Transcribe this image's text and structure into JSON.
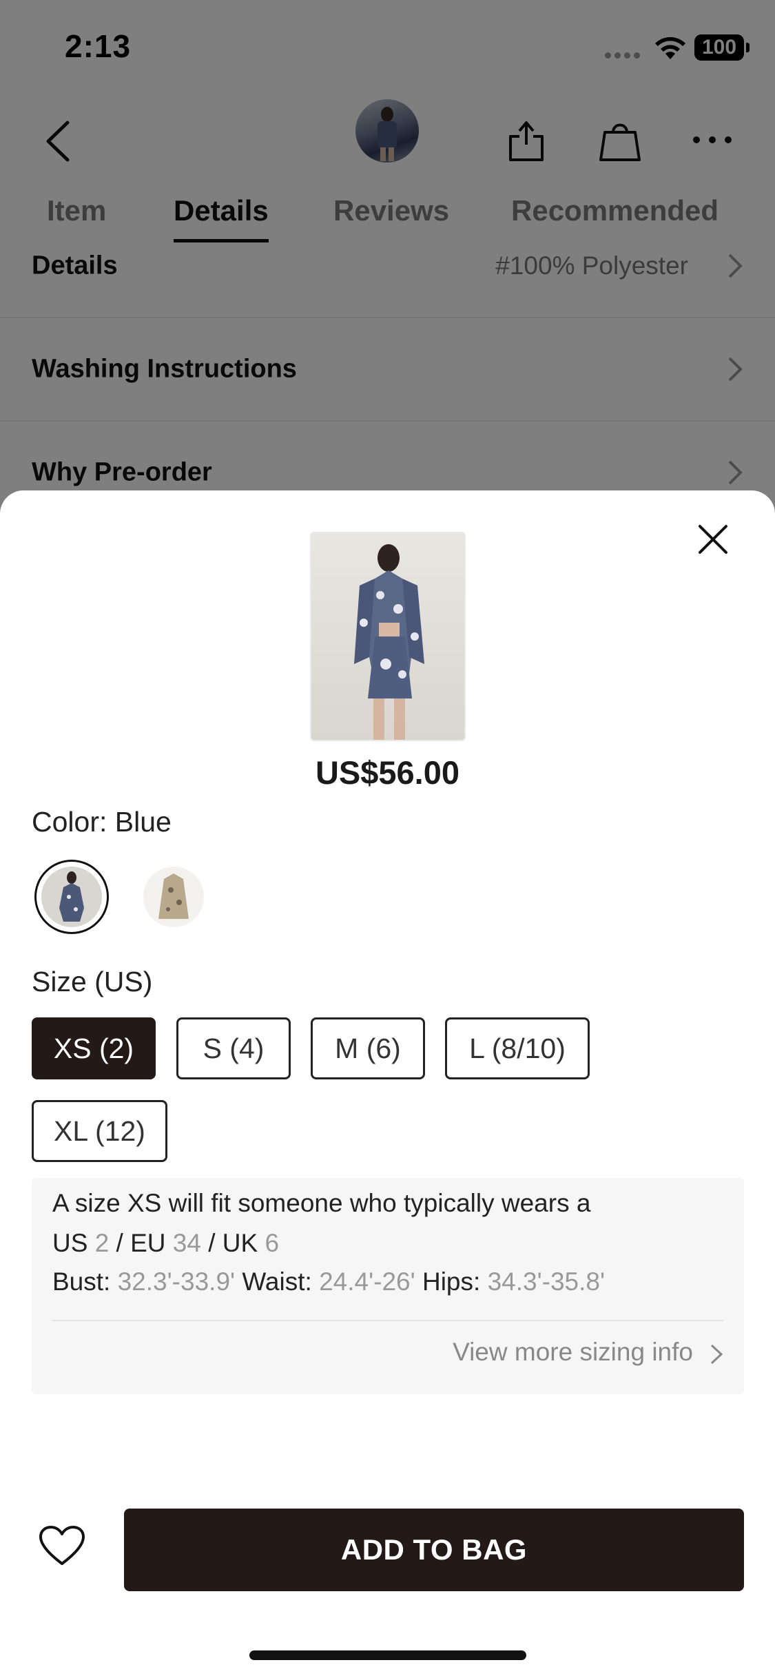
{
  "status_bar": {
    "time": "2:13",
    "battery": "100"
  },
  "nav": {
    "back_icon": "chevron-left-icon",
    "share_icon": "share-icon",
    "bag_icon": "shopping-bag-icon",
    "more_icon": "more-dots-icon"
  },
  "tabs": [
    {
      "label": "Item",
      "active": false
    },
    {
      "label": "Details",
      "active": true
    },
    {
      "label": "Reviews",
      "active": false
    },
    {
      "label": "Recommended",
      "active": false
    }
  ],
  "detail_rows": [
    {
      "label": "Details",
      "value": "#100% Polyester"
    },
    {
      "label": "Washing Instructions",
      "value": ""
    },
    {
      "label": "Why Pre-order",
      "value": ""
    }
  ],
  "sheet": {
    "price": "US$56.00",
    "color_label": "Color: Blue",
    "colors": [
      {
        "name": "Blue",
        "selected": true,
        "tone": "#4b5878"
      },
      {
        "name": "Beige",
        "selected": false,
        "tone": "#b8a88c"
      }
    ],
    "size_label": "Size (US)",
    "sizes": [
      {
        "label": "XS (2)",
        "selected": true
      },
      {
        "label": "S (4)",
        "selected": false
      },
      {
        "label": "M (6)",
        "selected": false
      },
      {
        "label": "L (8/10)",
        "selected": false
      },
      {
        "label": "XL (12)",
        "selected": false
      }
    ],
    "size_info": {
      "intro": "A size XS will fit someone who typically wears a",
      "us_label": "US",
      "us_value": "2",
      "eu_label": "/ EU",
      "eu_value": "34",
      "uk_label": "/ UK",
      "uk_value": "6",
      "bust_label": "Bust:",
      "bust_value": "32.3'-33.9'",
      "waist_label": "Waist:",
      "waist_value": "24.4'-26'",
      "hips_label": "Hips:",
      "hips_value": "34.3'-35.8'",
      "more_link": "View more sizing info"
    },
    "add_to_bag": "ADD TO BAG",
    "wishlist_icon": "heart-icon",
    "close_icon": "close-icon"
  },
  "colors": {
    "primary_dark": "#231a18",
    "muted_text": "#999999"
  }
}
